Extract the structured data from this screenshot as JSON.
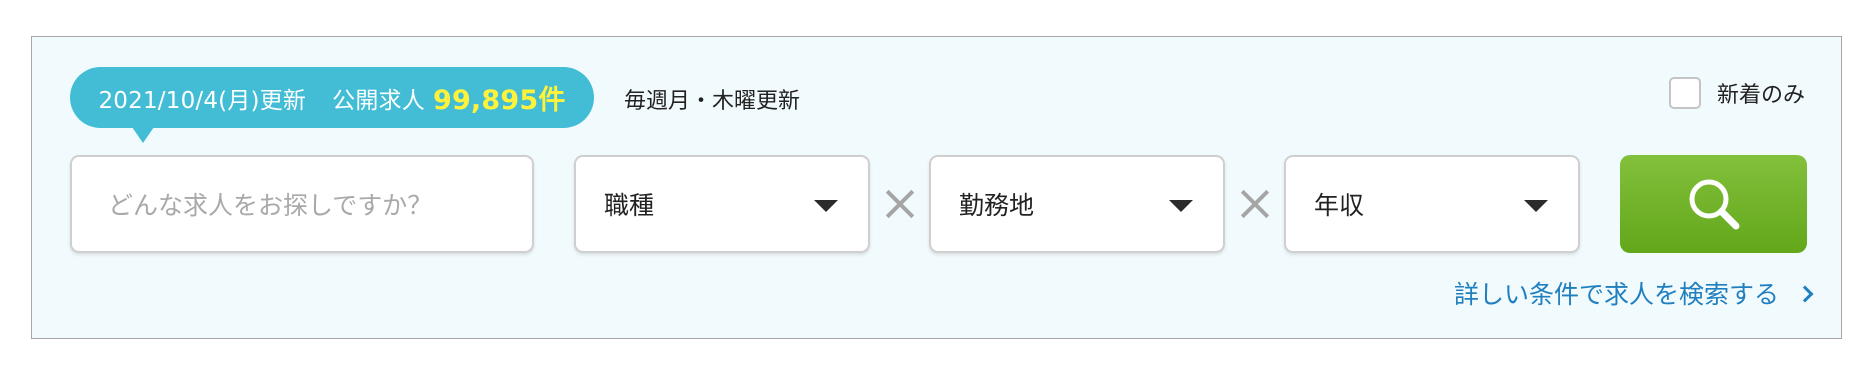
{
  "update_badge": {
    "date_text": "2021/10/4(月)更新",
    "jobs_label": "公開求人",
    "jobs_count": "99,895件"
  },
  "weekly_note": "毎週月・木曜更新",
  "new_only": {
    "label": "新着のみ",
    "checked": false
  },
  "search": {
    "keyword_placeholder": "どんな求人をお探しですか？",
    "job_type": "職種",
    "location": "勤務地",
    "income": "年収",
    "button_icon": "search-icon"
  },
  "advanced_link": "詳しい条件で求人を検索する",
  "colors": {
    "panel_bg": "#f1fafd",
    "badge_bg": "#42bdd5",
    "count_highlight": "#fff23b",
    "search_button": "#6db128",
    "link": "#1f7fbf"
  }
}
